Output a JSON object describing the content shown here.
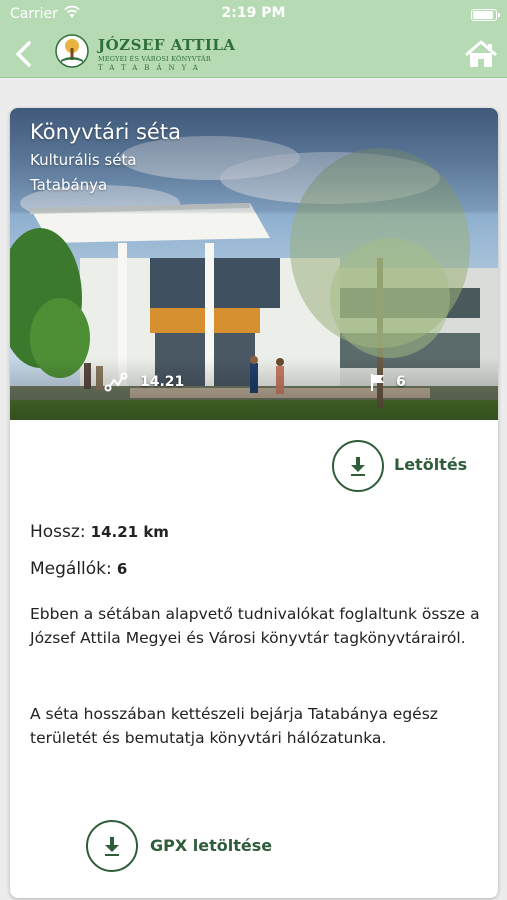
{
  "status_bar": {
    "carrier": "Carrier",
    "time": "2:19 PM"
  },
  "nav": {
    "logo_line1": "JÓZSEF ATTILA",
    "logo_line2": "MEGYEI ÉS VÁROSI KÖNYVTÁR",
    "logo_line3": "TATABÁNYA",
    "back_icon": "chevron-left-icon",
    "home_icon": "home-icon"
  },
  "walk": {
    "title": "Könyvtári séta",
    "category": "Kulturális séta",
    "city": "Tatabánya",
    "distance": "14.21",
    "stops": "6"
  },
  "actions": {
    "download_label": "Letöltés",
    "gpx_label": "GPX letöltése"
  },
  "details": {
    "length_label": "Hossz:",
    "length_value": "14.21 km",
    "stops_label": "Megállók:",
    "stops_value": "6",
    "description_1": "Ebben a sétában alapvető tudnivalókat foglaltunk össze a József Attila Megyei és Városi könyvtár tagkönyvtárairól.",
    "description_2": "A séta hosszában kettészeli bejárja Tatabánya egész területét és bemutatja könyvtári hálózatunka."
  },
  "colors": {
    "bar": "#b6dbb4",
    "accent": "#2f5d3a"
  }
}
